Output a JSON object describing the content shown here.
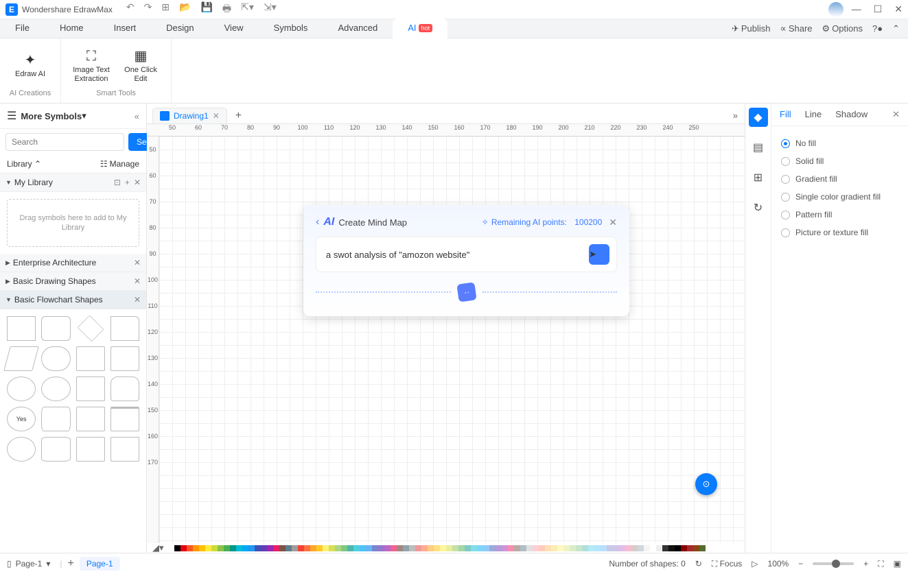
{
  "app": {
    "name": "Wondershare EdrawMax"
  },
  "menu": {
    "tabs": [
      "File",
      "Home",
      "Insert",
      "Design",
      "View",
      "Symbols",
      "Advanced",
      "AI"
    ],
    "activeIndex": 7,
    "aiBadge": "hot",
    "actions": {
      "publish": "Publish",
      "share": "Share",
      "options": "Options"
    }
  },
  "ribbon": {
    "groups": [
      {
        "label": "AI Creations",
        "items": [
          {
            "label": "Edraw AI"
          }
        ]
      },
      {
        "label": "Smart Tools",
        "items": [
          {
            "label": "Image Text Extraction"
          },
          {
            "label": "One Click Edit"
          }
        ]
      }
    ]
  },
  "leftPanel": {
    "header": "More Symbols",
    "searchPlaceholder": "Search",
    "searchButton": "Search",
    "libraryLabel": "Library",
    "manageLabel": "Manage",
    "dropZoneText": "Drag symbols here to add to My Library",
    "sections": [
      {
        "label": "My Library",
        "expanded": true
      },
      {
        "label": "Enterprise Architecture",
        "expanded": false
      },
      {
        "label": "Basic Drawing Shapes",
        "expanded": false
      },
      {
        "label": "Basic Flowchart Shapes",
        "expanded": true
      }
    ]
  },
  "documentTabs": {
    "current": "Drawing1"
  },
  "rulerH": [
    "50",
    "60",
    "70",
    "80",
    "90",
    "100",
    "110",
    "120",
    "130",
    "140",
    "150",
    "160",
    "170",
    "180",
    "190",
    "200",
    "210",
    "220",
    "230",
    "240",
    "250"
  ],
  "rulerV": [
    "50",
    "60",
    "70",
    "80",
    "90",
    "100",
    "110",
    "120",
    "130",
    "140",
    "150",
    "160",
    "170"
  ],
  "aiDialog": {
    "title": "Create Mind Map",
    "pointsLabel": "Remaining AI points:",
    "pointsValue": "100200",
    "prompt": "a swot analysis of \"amozon website\""
  },
  "rightPanel": {
    "tabs": [
      "Fill",
      "Line",
      "Shadow"
    ],
    "activeIndex": 0,
    "fillOptions": [
      "No fill",
      "Solid fill",
      "Gradient fill",
      "Single color gradient fill",
      "Pattern fill",
      "Picture or texture fill"
    ],
    "selectedFill": 0
  },
  "statusBar": {
    "pageLabel": "Page-1",
    "pageTab": "Page-1",
    "shapesLabel": "Number of shapes:",
    "shapesCount": "0",
    "focusLabel": "Focus",
    "zoom": "100%"
  },
  "colorPalette": [
    "#fff",
    "#000",
    "#e60012",
    "#ff5722",
    "#ff9800",
    "#ffc107",
    "#ffeb3b",
    "#cddc39",
    "#8bc34a",
    "#4caf50",
    "#009688",
    "#00bcd4",
    "#03a9f4",
    "#2196f3",
    "#3f51b5",
    "#673ab7",
    "#9c27b0",
    "#e91e63",
    "#795548",
    "#607d8b",
    "#9e9e9e",
    "#f44336",
    "#ff7043",
    "#ffa726",
    "#ffca28",
    "#fff176",
    "#d4e157",
    "#aed581",
    "#81c784",
    "#4db6ac",
    "#4dd0e1",
    "#4fc3f7",
    "#64b5f6",
    "#7986cb",
    "#9575cd",
    "#ba68c8",
    "#f06292",
    "#a1887f",
    "#90a4ae",
    "#bdbdbd",
    "#ef9a9a",
    "#ffab91",
    "#ffcc80",
    "#ffe082",
    "#fff59d",
    "#e6ee9c",
    "#c5e1a5",
    "#a5d6a7",
    "#80cbc4",
    "#80deea",
    "#81d4fa",
    "#90caf9",
    "#9fa8da",
    "#b39ddb",
    "#ce93d8",
    "#f48fb1",
    "#bcaaa4",
    "#b0bec5",
    "#e0e0e0",
    "#ffcdd2",
    "#ffccbc",
    "#ffe0b2",
    "#ffecb3",
    "#fff9c4",
    "#f0f4c3",
    "#dcedc8",
    "#c8e6c9",
    "#b2dfdb",
    "#b2ebf2",
    "#b3e5fc",
    "#bbdefb",
    "#c5cae9",
    "#d1c4e9",
    "#e1bee7",
    "#f8bbd0",
    "#d7ccc8",
    "#cfd8dc",
    "#f5f5f5",
    "#fff",
    "#eee",
    "#333",
    "#111",
    "#000",
    "#8b0000",
    "#a52a2a",
    "#8b4513",
    "#556b2f"
  ]
}
